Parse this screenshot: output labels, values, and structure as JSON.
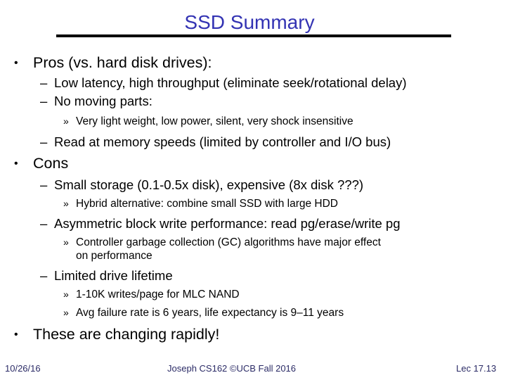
{
  "slide": {
    "title": "SSD Summary",
    "bullets": {
      "pros": {
        "marker": "•",
        "text": "Pros (vs. hard disk drives):",
        "items": [
          {
            "marker": "–",
            "text": "Low latency, high throughput (eliminate seek/rotational delay)"
          },
          {
            "marker": "–",
            "text": "No moving parts:"
          },
          {
            "marker": "»",
            "text": "Very light weight, low power, silent, very shock insensitive"
          },
          {
            "marker": "–",
            "text": "Read at memory speeds (limited by controller and I/O bus)"
          }
        ]
      },
      "cons": {
        "marker": "•",
        "text": "Cons",
        "items": [
          {
            "marker": "–",
            "text": "Small storage (0.1-0.5x disk), expensive (8x disk  ???)"
          },
          {
            "marker": "»",
            "text": "Hybrid alternative: combine small SSD with large HDD"
          },
          {
            "marker": "–",
            "text": "Asymmetric block write performance: read pg/erase/write pg"
          },
          {
            "marker": "»",
            "text": "Controller garbage collection (GC) algorithms have major effect",
            "continuation": "on performance"
          },
          {
            "marker": "–",
            "text": "Limited drive lifetime"
          },
          {
            "marker": "»",
            "text": "1-10K writes/page for MLC NAND"
          },
          {
            "marker": "»",
            "text": "Avg failure rate is 6 years, life expectancy is 9–11 years"
          }
        ]
      },
      "changing": {
        "marker": "•",
        "text": "These are changing rapidly!"
      }
    },
    "footer": {
      "date": "10/26/16",
      "center": "Joseph CS162 ©UCB Fall 2016",
      "page": "Lec 17.13"
    },
    "colors": {
      "title": "#3333b3",
      "text": "#000000",
      "footer": "#2b2b66"
    }
  }
}
